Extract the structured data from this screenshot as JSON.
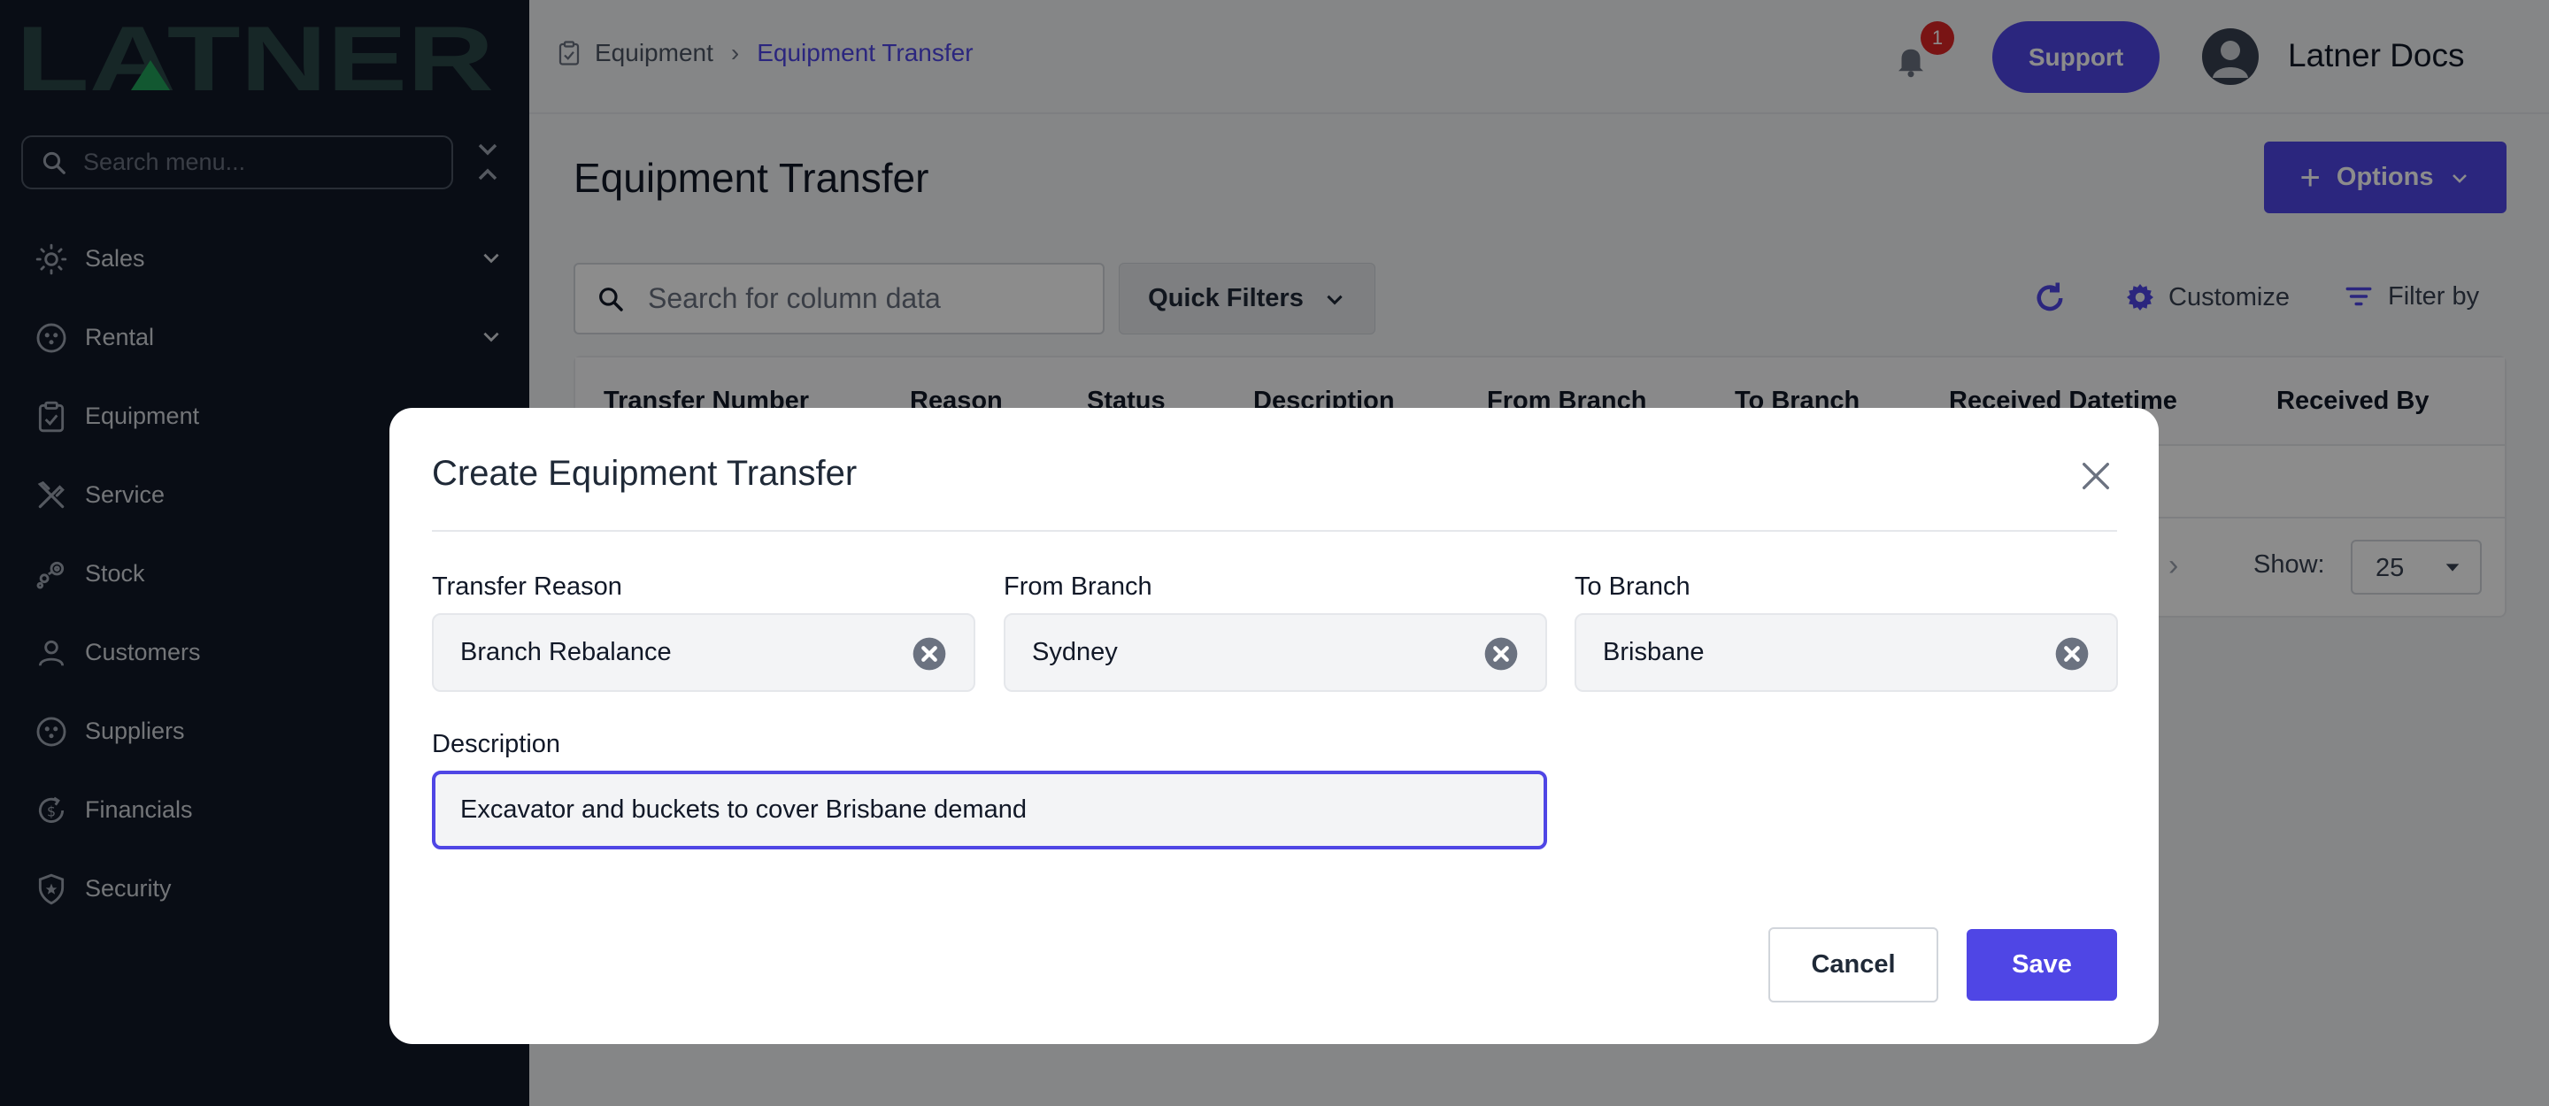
{
  "brand": {
    "logo_text": "LATNER",
    "accent": "#4f46e5",
    "logo_color": "#1e3a3a",
    "logo_triangle": "#1f9d55"
  },
  "sidebar": {
    "search_placeholder": "Search menu...",
    "items": [
      {
        "label": "Sales",
        "icon": "sales-icon",
        "expandable": true
      },
      {
        "label": "Rental",
        "icon": "rental-icon",
        "expandable": true
      },
      {
        "label": "Equipment",
        "icon": "equipment-icon",
        "expandable": false
      },
      {
        "label": "Service",
        "icon": "service-icon",
        "expandable": false
      },
      {
        "label": "Stock",
        "icon": "stock-icon",
        "expandable": false
      },
      {
        "label": "Customers",
        "icon": "customers-icon",
        "expandable": false
      },
      {
        "label": "Suppliers",
        "icon": "suppliers-icon",
        "expandable": false
      },
      {
        "label": "Financials",
        "icon": "financials-icon",
        "expandable": false
      },
      {
        "label": "Security",
        "icon": "security-icon",
        "expandable": false
      }
    ]
  },
  "header": {
    "breadcrumb": [
      "Equipment",
      "Equipment Transfer"
    ],
    "notification_count": "1",
    "support_label": "Support",
    "user_name": "Latner Docs"
  },
  "main": {
    "title": "Equipment Transfer",
    "options_label": "Options",
    "search_placeholder": "Search for column data",
    "quick_filters_label": "Quick Filters",
    "customize_label": "Customize",
    "filter_by_label": "Filter by",
    "columns": [
      "Transfer Number",
      "Reason",
      "Status",
      "Description",
      "From Branch",
      "To Branch",
      "Received Datetime",
      "Received By"
    ],
    "show_label": "Show:",
    "page_size": "25"
  },
  "modal": {
    "title": "Create Equipment Transfer",
    "transfer_reason_label": "Transfer Reason",
    "transfer_reason_value": "Branch Rebalance",
    "from_branch_label": "From Branch",
    "from_branch_value": "Sydney",
    "to_branch_label": "To Branch",
    "to_branch_value": "Brisbane",
    "description_label": "Description",
    "description_value": "Excavator and buckets to cover Brisbane demand",
    "cancel_label": "Cancel",
    "save_label": "Save"
  }
}
